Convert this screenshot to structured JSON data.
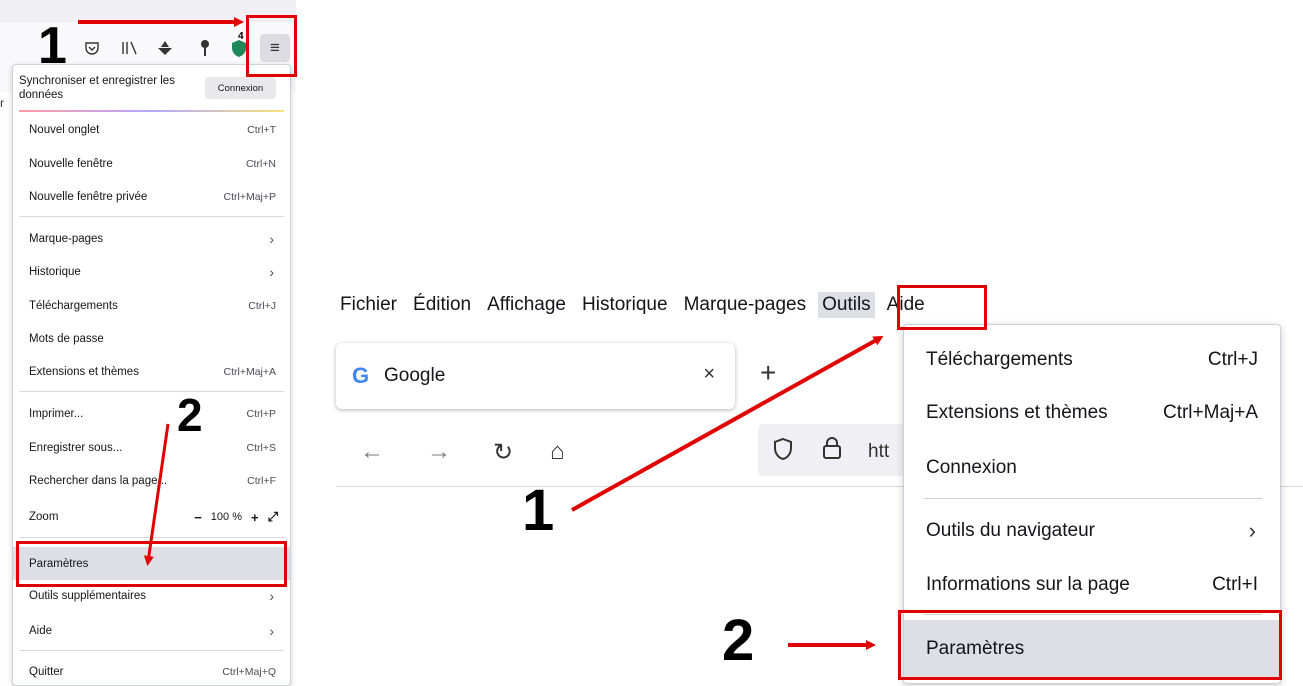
{
  "colors": {
    "annotation_red": "#e00000",
    "highlight": "#dedee5",
    "google_blue": "#4285f4"
  },
  "left": {
    "toolbar_icons": [
      "pocket-icon",
      "library-icon",
      "extension-icon",
      "key-icon",
      "shield-extension-icon"
    ],
    "badge": "4",
    "menu_glyph": "≡",
    "sync": {
      "text": "Synchroniser et enregistrer les données",
      "button": "Connexion"
    },
    "items": [
      {
        "label": "Nouvel onglet",
        "shortcut": "Ctrl+T"
      },
      {
        "label": "Nouvelle fenêtre",
        "shortcut": "Ctrl+N"
      },
      {
        "label": "Nouvelle fenêtre privée",
        "shortcut": "Ctrl+Maj+P"
      },
      {
        "label": "Marque-pages",
        "shortcut": ""
      },
      {
        "label": "Historique",
        "shortcut": ""
      },
      {
        "label": "Téléchargements",
        "shortcut": "Ctrl+J"
      },
      {
        "label": "Mots de passe",
        "shortcut": ""
      },
      {
        "label": "Extensions et thèmes",
        "shortcut": "Ctrl+Maj+A"
      },
      {
        "label": "Imprimer...",
        "shortcut": "Ctrl+P"
      },
      {
        "label": "Enregistrer sous...",
        "shortcut": "Ctrl+S"
      },
      {
        "label": "Rechercher dans la page...",
        "shortcut": "Ctrl+F"
      },
      {
        "label": "Zoom",
        "shortcut": ""
      },
      {
        "label": "Paramètres",
        "shortcut": ""
      },
      {
        "label": "Outils supplémentaires",
        "shortcut": ""
      },
      {
        "label": "Aide",
        "shortcut": ""
      },
      {
        "label": "Quitter",
        "shortcut": "Ctrl+Maj+Q"
      }
    ],
    "zoom": {
      "minus": "−",
      "value": "100 %",
      "plus": "+",
      "fullscreen": "⤢"
    },
    "chevron": "›"
  },
  "right": {
    "menubar": [
      "Fichier",
      "Édition",
      "Affichage",
      "Historique",
      "Marque-pages",
      "Outils",
      "Aide"
    ],
    "tab": {
      "favicon": "G",
      "title": "Google",
      "close": "×"
    },
    "new_tab": "+",
    "nav": {
      "back": "←",
      "forward": "→",
      "reload": "↻",
      "home": "⌂"
    },
    "url_partial": "htt",
    "dropdown": [
      {
        "label": "Téléchargements",
        "shortcut": "Ctrl+J"
      },
      {
        "label": "Extensions et thèmes",
        "shortcut": "Ctrl+Maj+A"
      },
      {
        "label": "Connexion",
        "shortcut": ""
      },
      {
        "label": "Outils du navigateur",
        "shortcut": ""
      },
      {
        "label": "Informations sur la page",
        "shortcut": "Ctrl+I"
      },
      {
        "label": "Paramètres",
        "shortcut": ""
      }
    ],
    "chevron": "›"
  },
  "annotations": {
    "step1": "1",
    "step2": "2"
  }
}
